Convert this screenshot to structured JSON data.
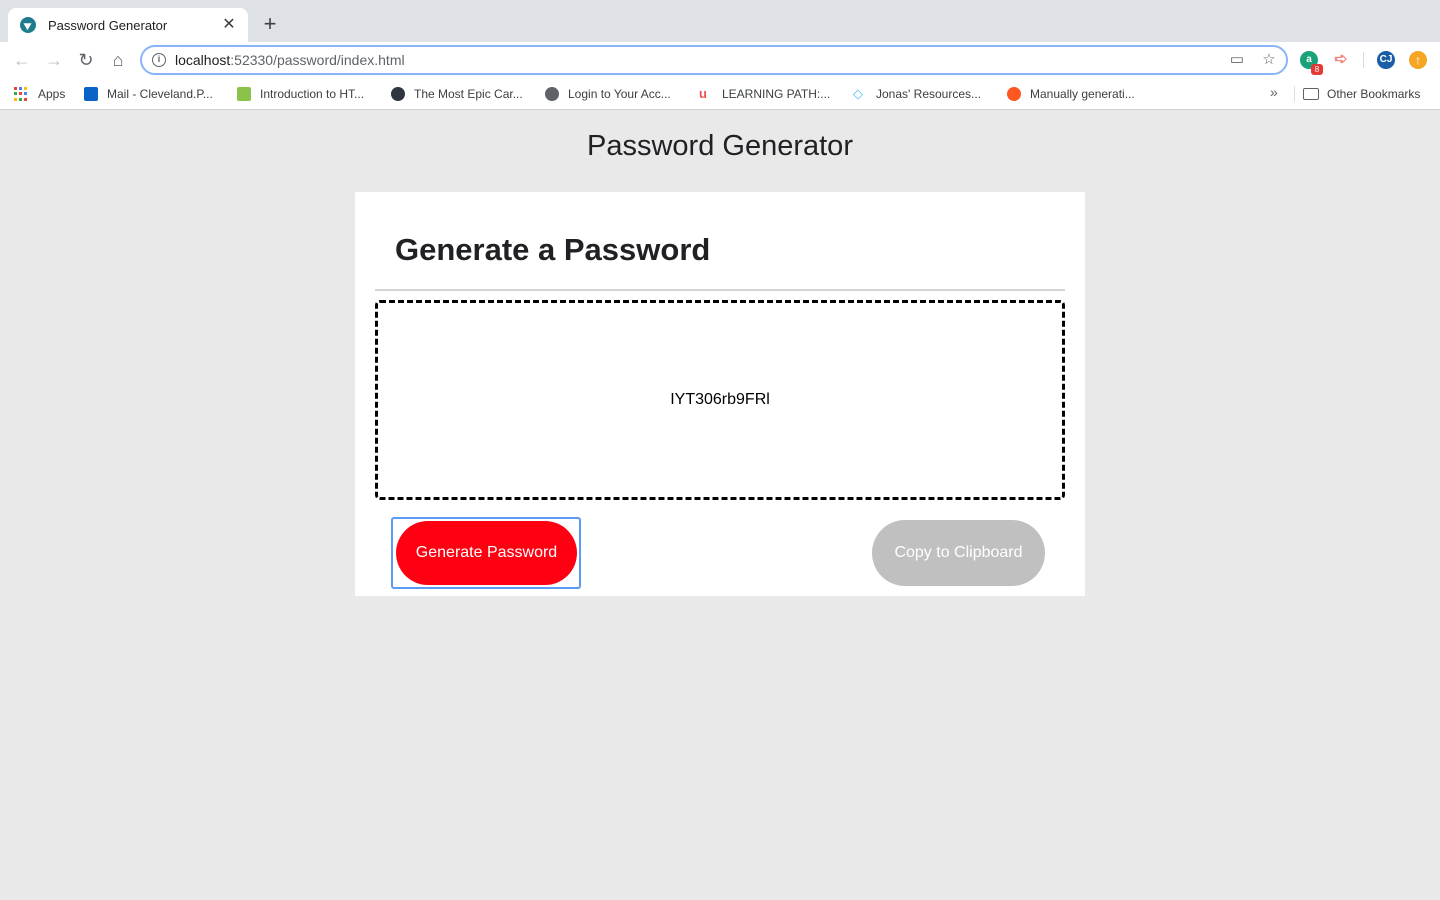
{
  "browser": {
    "tab_title": "Password Generator",
    "tab_close": "✕",
    "new_tab": "+",
    "url_host": "localhost",
    "url_rest": ":52330/password/index.html",
    "profile_initials": "CJ",
    "extension_badge": "8",
    "bookmarks": [
      {
        "label": "Apps",
        "icon": "apps-grid-icon"
      },
      {
        "label": "Mail - Cleveland.P...",
        "icon": "outlook-icon",
        "color": "#0a64c8"
      },
      {
        "label": "Introduction to HT...",
        "icon": "course-icon",
        "color": "#8bc34a"
      },
      {
        "label": "The Most Epic Car...",
        "icon": "site-icon",
        "color": "#2f3640"
      },
      {
        "label": "Login to Your Acc...",
        "icon": "globe-icon",
        "color": "#5f6368"
      },
      {
        "label": "LEARNING PATH:...",
        "icon": "udemy-icon",
        "color": "#ec5252"
      },
      {
        "label": "Jonas' Resources...",
        "icon": "diamond-icon",
        "color": "#4fc3f7"
      },
      {
        "label": "Manually generati...",
        "icon": "plus-circle-icon",
        "color": "#ff5722"
      }
    ],
    "other_bookmarks": "Other Bookmarks",
    "overflow": "»"
  },
  "page": {
    "title": "Password Generator",
    "card_header": "Generate a Password",
    "password": "IYT306rb9FRl",
    "generate_button": "Generate Password",
    "copy_button": "Copy to Clipboard"
  },
  "colors": {
    "generate_button": "#ff0013",
    "copy_button_disabled": "#c0c0c0",
    "page_background": "#e9e9e9",
    "focus_ring": "#5b9af5"
  }
}
